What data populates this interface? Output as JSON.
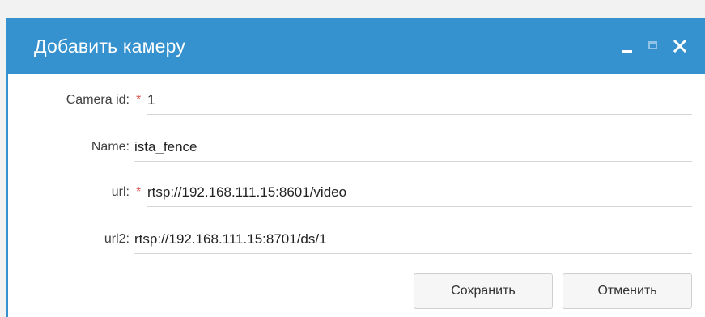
{
  "window": {
    "title": "Добавить камеру",
    "accent_color": "#3592cf",
    "tools": [
      "minimize-icon",
      "maximize-icon",
      "close-icon"
    ]
  },
  "form": {
    "fields": [
      {
        "label": "Camera id:",
        "required": true,
        "value": "1"
      },
      {
        "label": "Name:",
        "required": false,
        "value": "ista_fence"
      },
      {
        "label": "url:",
        "required": true,
        "value": "rtsp://192.168.111.15:8601/video"
      },
      {
        "label": "url2:",
        "required": false,
        "value": "rtsp://192.168.111.15:8701/ds/1"
      }
    ],
    "required_marker": "*"
  },
  "buttons": {
    "save_label": "Сохранить",
    "cancel_label": "Отменить"
  }
}
